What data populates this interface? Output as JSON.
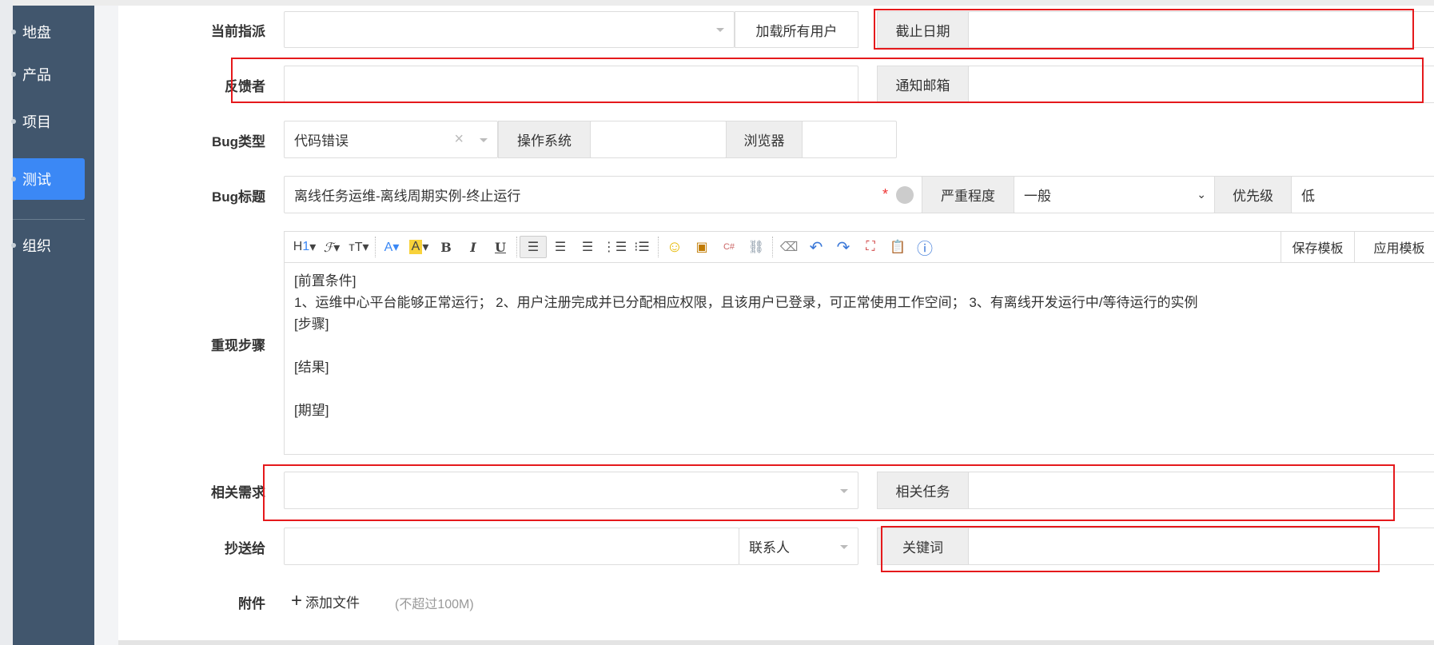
{
  "sidebar": {
    "items": [
      {
        "label": "地盘"
      },
      {
        "label": "产品"
      },
      {
        "label": "项目"
      },
      {
        "label": "测试",
        "active": true
      },
      {
        "label": "组织"
      }
    ]
  },
  "form": {
    "assigned_label": "当前指派",
    "load_all_users": "加载所有用户",
    "deadline_label": "截止日期",
    "feedback_label": "反馈者",
    "notify_email_label": "通知邮箱",
    "bug_type_label": "Bug类型",
    "bug_type_value": "代码错误",
    "os_label": "操作系统",
    "browser_label": "浏览器",
    "bug_title_label": "Bug标题",
    "bug_title_value": "离线任务运维-离线周期实例-终止运行",
    "required_mark": "*",
    "severity_label": "严重程度",
    "severity_value": "一般",
    "priority_label": "优先级",
    "priority_value": "低",
    "steps_label": "重现步骤",
    "save_template": "保存模板",
    "apply_template": "应用模板",
    "steps_lines": [
      "[前置条件]",
      "1、运维中心平台能够正常运行； 2、用户注册完成并已分配相应权限，且该用户已登录，可正常使用工作空间； 3、有离线开发运行中/等待运行的实例",
      "[步骤]",
      "",
      "[结果]",
      "",
      "[期望]"
    ],
    "related_story_label": "相关需求",
    "related_task_label": "相关任务",
    "cc_label": "抄送给",
    "contacts_label": "联系人",
    "keywords_label": "关键词",
    "attachment_label": "附件",
    "add_file": "添加文件",
    "file_limit": "(不超过100M)"
  },
  "colors": {
    "sidebar": "#41566d",
    "active": "#3b88f5",
    "highlight": "#e5191c"
  }
}
